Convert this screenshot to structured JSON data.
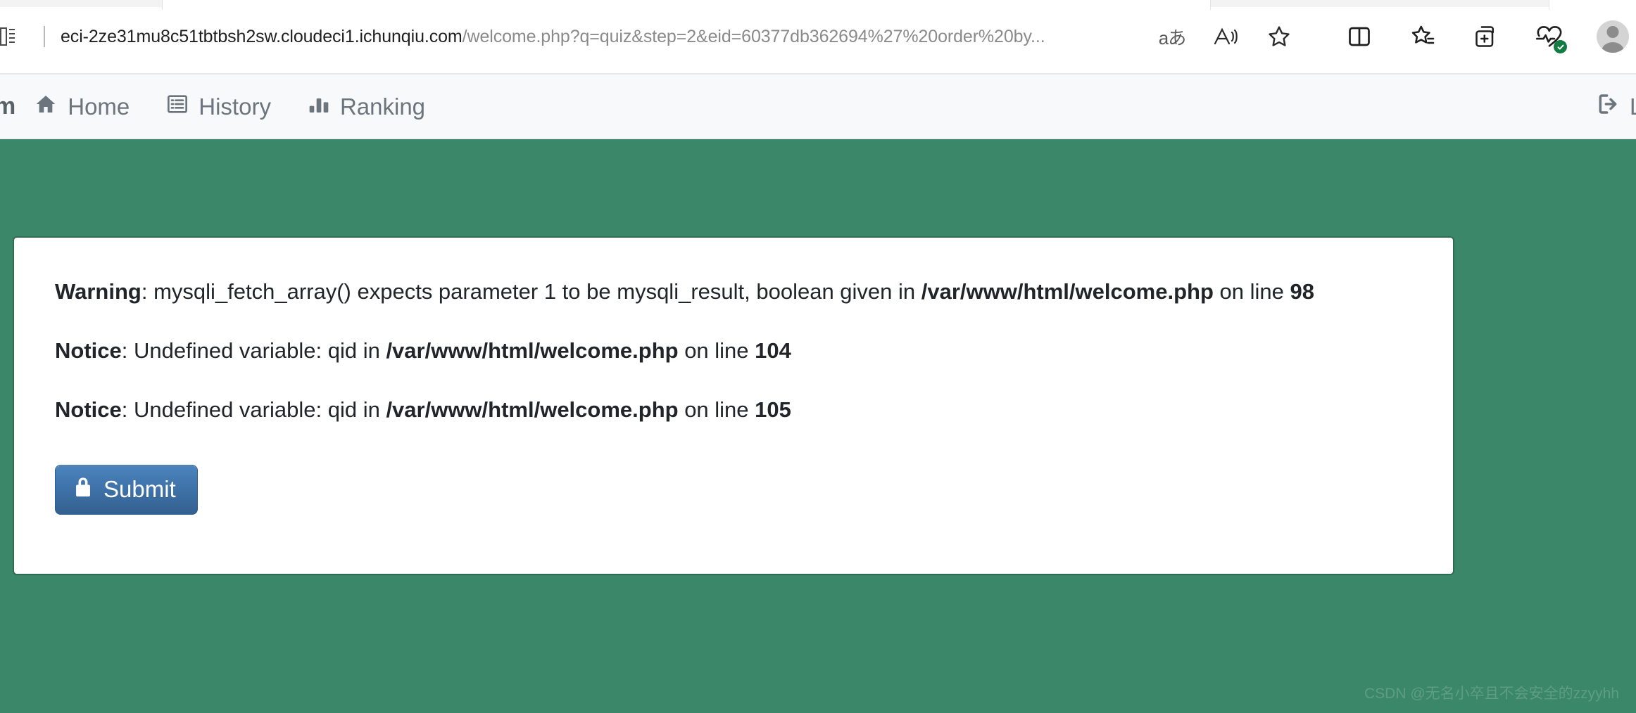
{
  "browser": {
    "url": {
      "host": "eci-2ze31mu8c51tbtbsh2sw.cloudeci1.ichunqiu.com",
      "path": "/welcome.php?q=quiz&step=2&eid=60377db362694%27%20order%20by...",
      "full": "eci-2ze31mu8c51tbtbsh2sw.cloudeci1.ichunqiu.com/welcome.php?q=quiz&step=2&eid=60377db362694%27%20order%20by..."
    },
    "icons": {
      "reading_view": "reading-view-icon",
      "translate": "aあ",
      "read_aloud": "read-aloud-icon",
      "favorite": "favorite-star-icon",
      "split_screen": "split-screen-icon",
      "collections": "collections-icon",
      "add_to_tabs": "add-tab-icon",
      "browser_essentials": "browser-essentials-icon",
      "profile": "profile-avatar-icon"
    },
    "accent": "#3b8769"
  },
  "site_nav": {
    "brand": "m",
    "items": [
      {
        "label": "Home",
        "icon": "home-icon"
      },
      {
        "label": "History",
        "icon": "list-alt-icon"
      },
      {
        "label": "Ranking",
        "icon": "bar-chart-icon"
      }
    ],
    "logout": {
      "label": "Log",
      "icon": "sign-out-icon"
    }
  },
  "content": {
    "messages": [
      {
        "level": "Warning",
        "text": ": mysqli_fetch_array() expects parameter 1 to be mysqli_result, boolean given in ",
        "file": "/var/www/html/welcome.php",
        "on_line_label": " on line ",
        "line": "98"
      },
      {
        "level": "Notice",
        "text": ": Undefined variable: qid in ",
        "file": "/var/www/html/welcome.php",
        "on_line_label": " on line ",
        "line": "104"
      },
      {
        "level": "Notice",
        "text": ": Undefined variable: qid in ",
        "file": "/var/www/html/welcome.php",
        "on_line_label": " on line ",
        "line": "105"
      }
    ],
    "submit": {
      "label": "Submit",
      "icon": "lock-icon"
    }
  },
  "watermark": "CSDN @无名小卒且不会安全的zzyyhh"
}
